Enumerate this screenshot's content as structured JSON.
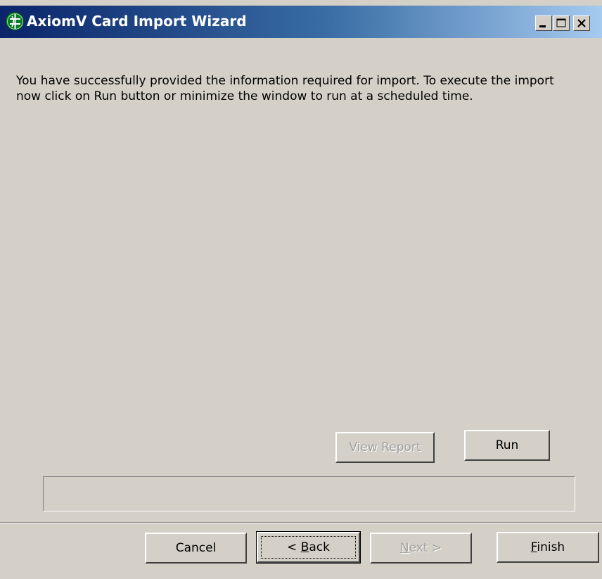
{
  "window": {
    "title": "AxiomV  Card Import Wizard",
    "controls": {
      "minimize": "minimize-icon",
      "maximize": "maximize-icon",
      "close": "close-icon"
    }
  },
  "message": "You have successfully provided the information required for import. To execute the import now click on Run button or minimize the window to run at a scheduled time.",
  "actions": {
    "view_report": "View Report",
    "run": "Run"
  },
  "footer": {
    "cancel": "Cancel",
    "back_prefix": "< ",
    "back_accel": "B",
    "back_rest": "ack",
    "next_accel": "N",
    "next_rest": "ext >",
    "finish_accel": "F",
    "finish_rest": "inish"
  },
  "colors": {
    "titlebar_start": "#0a246a",
    "titlebar_end": "#a6caf0",
    "face": "#d4d0c8",
    "disabled_text": "#a0a0a0"
  }
}
